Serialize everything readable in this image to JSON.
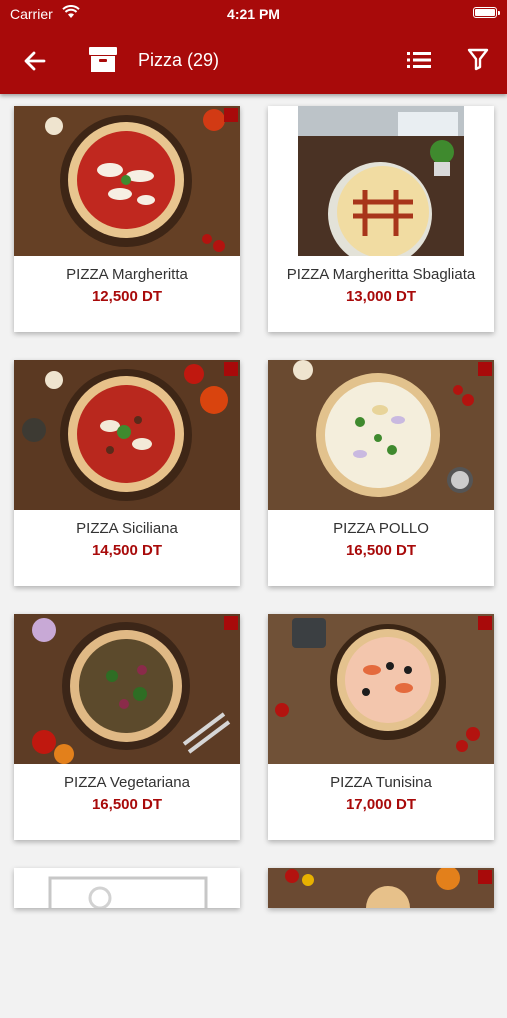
{
  "status": {
    "carrier": "Carrier",
    "time": "4:21 PM"
  },
  "header": {
    "title": "Pizza (29)"
  },
  "products": [
    {
      "name": "PIZZA Margheritta",
      "price": "12,500 DT"
    },
    {
      "name": "PIZZA Margheritta Sbagliata",
      "price": "13,000 DT"
    },
    {
      "name": "PIZZA Siciliana",
      "price": "14,500 DT"
    },
    {
      "name": "PIZZA POLLO",
      "price": "16,500 DT"
    },
    {
      "name": "PIZZA Vegetariana",
      "price": "16,500 DT"
    },
    {
      "name": "PIZZA Tunisina",
      "price": "17,000 DT"
    }
  ],
  "theme": {
    "primary": "#a80a0a",
    "background": "#f2f2f2"
  }
}
